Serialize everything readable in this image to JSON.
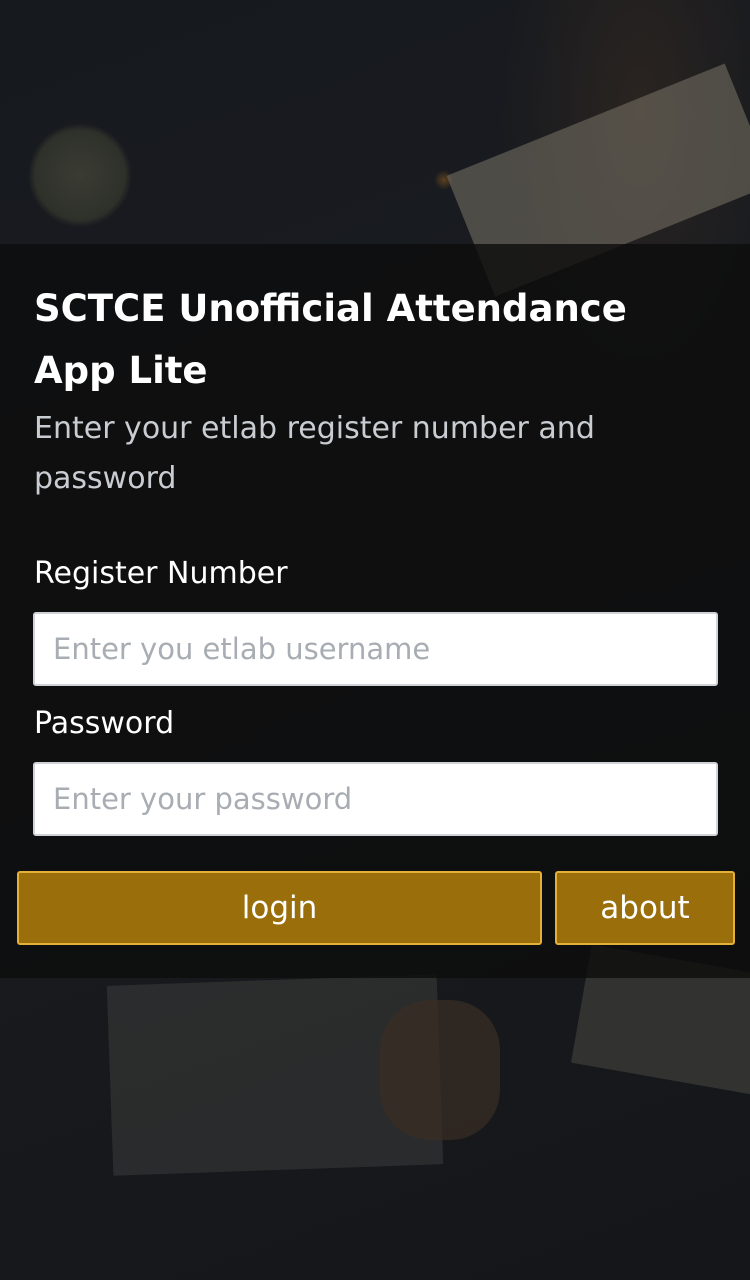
{
  "app": {
    "title": "SCTCE Unofficial Attendance App Lite",
    "subtitle": "Enter your etlab register number and password"
  },
  "form": {
    "register_label": "Register Number",
    "register_placeholder": "Enter you etlab username",
    "register_value": "",
    "password_label": "Password",
    "password_placeholder": "Enter your password",
    "password_value": ""
  },
  "buttons": {
    "login_label": "login",
    "about_label": "about"
  },
  "colors": {
    "button_fill": "#9a6e0a",
    "button_border": "#e5b03a",
    "panel_overlay": "rgba(12,12,12,0.80)"
  }
}
